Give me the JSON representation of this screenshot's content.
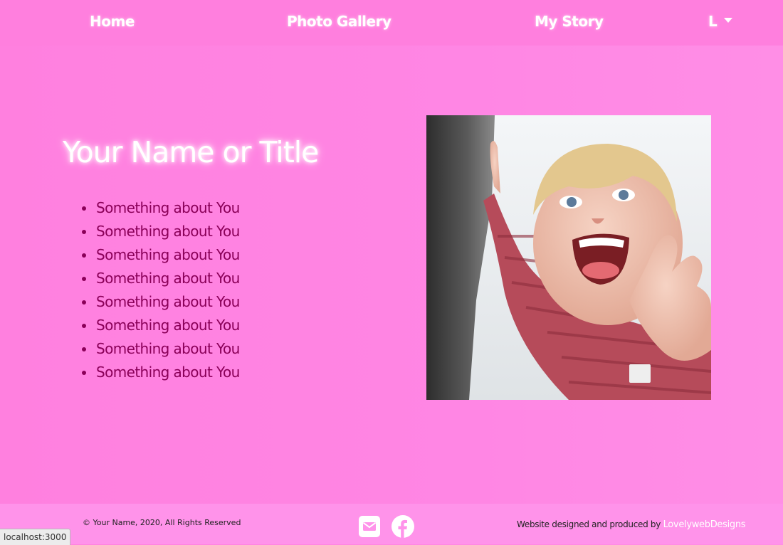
{
  "nav": {
    "home": "Home",
    "gallery": "Photo Gallery",
    "story": "My Story",
    "dropdown": "L"
  },
  "hero": {
    "title": "Your Name or Title",
    "items": [
      "Something about You",
      "Something about You",
      "Something about You",
      "Something about You",
      "Something about You",
      "Something about You",
      "Something about You",
      "Something about You"
    ]
  },
  "footer": {
    "copyright": "© Your Name, 2020, All Rights Reserved",
    "credit_text": "Website designed and produced by",
    "credit_link": "LovelywebDesigns",
    "icons": [
      "envelope-icon",
      "facebook-icon"
    ]
  },
  "status_bar": {
    "url": "localhost:3000"
  },
  "colors": {
    "nav_bg": "#ff7fde",
    "page_bg": "#ff86e4",
    "footer_bg": "#ff93ea",
    "list_text": "#8a0058",
    "title_text": "#ffffff"
  }
}
